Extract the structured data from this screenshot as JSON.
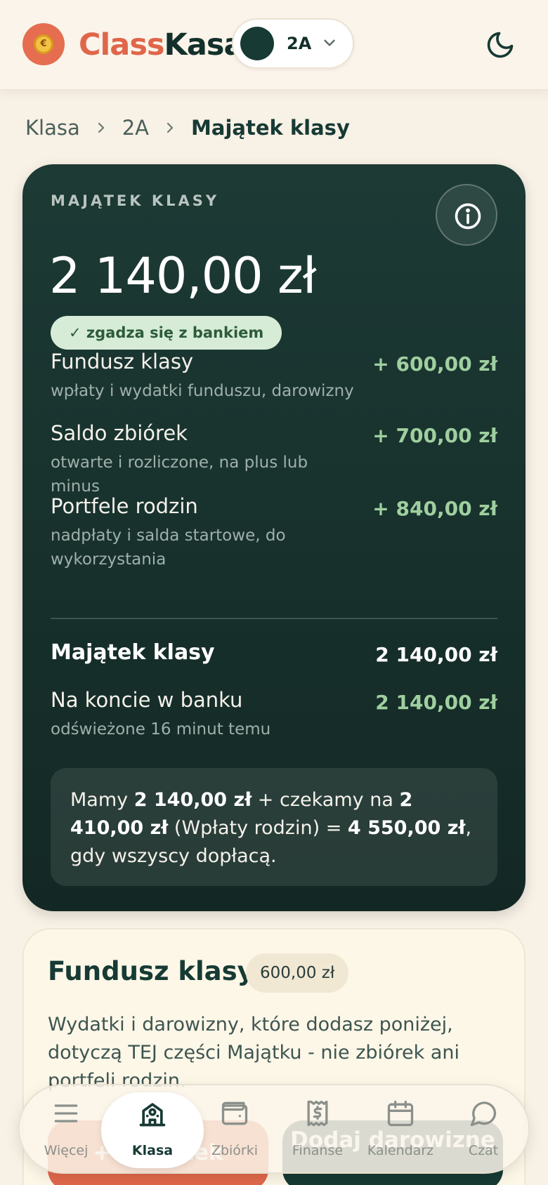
{
  "header": {
    "logo_coin": "€",
    "brand_part1": "Class",
    "brand_part2": "Kasa",
    "class_selector": "2A"
  },
  "breadcrumb": [
    "Klasa",
    "2A",
    "Majątek klasy"
  ],
  "assets": {
    "kicker": "MAJĄTEK KLASY",
    "amount": "2 140,00 zł",
    "status_badge": "✓ zgadza się z bankiem",
    "rows": [
      {
        "title": "Fundusz klasy",
        "sub": "wpłaty i wydatki funduszu, darowizny",
        "value": "+ 600,00 zł"
      },
      {
        "title": "Saldo zbiórek",
        "sub": "otwarte i rozliczone, na plus lub minus",
        "value": "+ 700,00 zł"
      },
      {
        "title": "Portfele rodzin",
        "sub": "nadpłaty i salda startowe, do wykorzystania",
        "value": "+ 840,00 zł"
      }
    ],
    "total": {
      "title": "Majątek klasy",
      "value": "2 140,00 zł"
    },
    "bank": {
      "title": "Na koncie w banku",
      "sub": "odświeżone 16 minut temu",
      "value": "2 140,00 zł"
    },
    "summary": {
      "t1": "Mamy ",
      "b1": "2 140,00 zł",
      "t2": " + czekamy na ",
      "b2": "2 410,00 zł",
      "t3": " (Wpłaty rodzin) = ",
      "b3": "4 550,00 zł",
      "t4": ", gdy wszyscy dopłacą."
    }
  },
  "fund": {
    "title": "Fundusz klasy",
    "chip": "600,00 zł",
    "description": "Wydatki i darowizny, które dodasz poniżej, dotyczą TEJ części Majątku - nie zbiórek ani portfeli rodzin.",
    "btn_add": "+ wydatek",
    "btn_donation": "Dodaj darowiznę"
  },
  "nav": [
    {
      "label": "Więcej",
      "icon": "menu-icon"
    },
    {
      "label": "Klasa",
      "icon": "school-icon"
    },
    {
      "label": "Zbiórki",
      "icon": "wallet-icon"
    },
    {
      "label": "Finanse",
      "icon": "receipt-dollar-icon"
    },
    {
      "label": "Kalendarz",
      "icon": "calendar-icon"
    },
    {
      "label": "Czat",
      "icon": "chat-icon"
    }
  ],
  "colors": {
    "accent": "#e0684b",
    "dark_green": "#173a34",
    "positive": "#9fcf9f",
    "background": "#f8f1e6"
  }
}
